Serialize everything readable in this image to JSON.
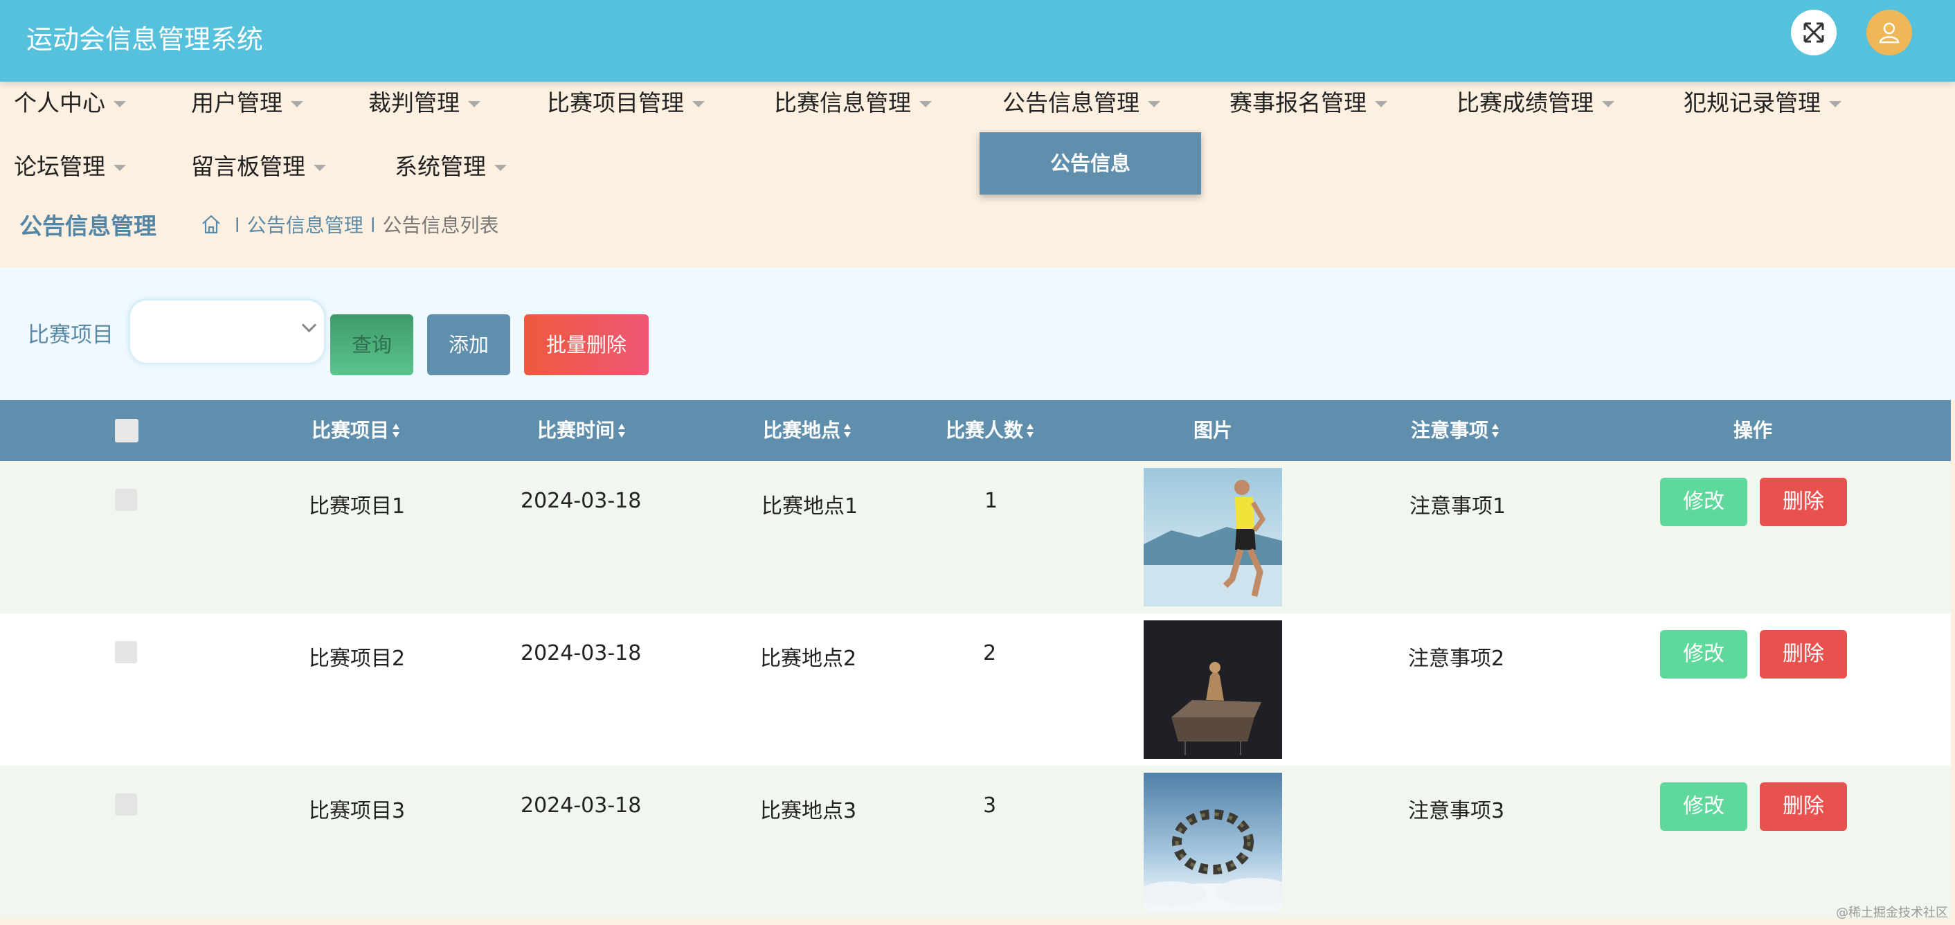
{
  "header": {
    "title": "运动会信息管理系统",
    "fullscreen_icon": "expand-arrows-icon",
    "user_icon": "user-avatar-icon"
  },
  "menu": {
    "items": [
      {
        "label": "个人中心"
      },
      {
        "label": "用户管理"
      },
      {
        "label": "裁判管理"
      },
      {
        "label": "比赛项目管理"
      },
      {
        "label": "比赛信息管理"
      },
      {
        "label": "公告信息管理"
      },
      {
        "label": "赛事报名管理"
      },
      {
        "label": "比赛成绩管理"
      },
      {
        "label": "犯规记录管理"
      },
      {
        "label": "论坛管理"
      },
      {
        "label": "留言板管理"
      },
      {
        "label": "系统管理"
      }
    ],
    "dropdown_item": "公告信息"
  },
  "breadcrumb": {
    "page_title": "公告信息管理",
    "home_icon": "home-icon",
    "level1": "公告信息管理",
    "level2": "公告信息列表",
    "separator": "l"
  },
  "search": {
    "label": "比赛项目",
    "select_value": "",
    "query_btn": "查询",
    "add_btn": "添加",
    "bulk_delete_btn": "批量删除"
  },
  "table": {
    "headers": {
      "project": "比赛项目",
      "time": "比赛时间",
      "place": "比赛地点",
      "count": "比赛人数",
      "image": "图片",
      "notes": "注意事项",
      "actions": "操作"
    },
    "rows": [
      {
        "project": "比赛项目1",
        "time": "2024-03-18",
        "place": "比赛地点1",
        "count": "1",
        "notes": "注意事项1",
        "edit": "修改",
        "delete": "删除",
        "image": "runner-photo"
      },
      {
        "project": "比赛项目2",
        "time": "2024-03-18",
        "place": "比赛地点2",
        "count": "2",
        "notes": "注意事项2",
        "edit": "修改",
        "delete": "删除",
        "image": "dark-stage-photo"
      },
      {
        "project": "比赛项目3",
        "time": "2024-03-18",
        "place": "比赛地点3",
        "count": "3",
        "notes": "注意事项3",
        "edit": "修改",
        "delete": "删除",
        "image": "skydivers-photo"
      }
    ]
  },
  "watermark": "@稀土掘金技术社区",
  "colors": {
    "header": "#55c1dc",
    "menu_bg": "#fdf0e0",
    "table_head": "#5f8fad",
    "edit": "#5fd89c",
    "delete": "#e8514e"
  }
}
